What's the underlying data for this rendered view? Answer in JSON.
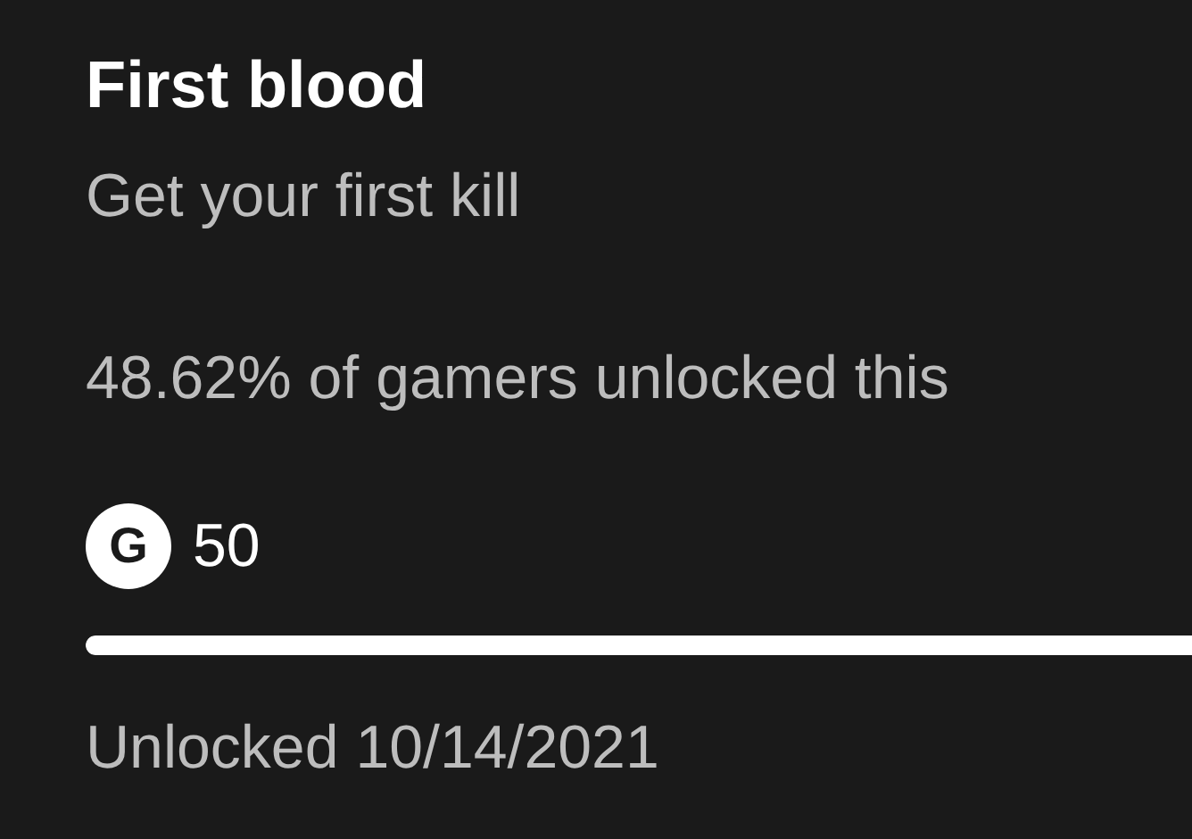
{
  "achievement": {
    "title": "First blood",
    "description": "Get your first kill",
    "rarity": "48.62% of gamers unlocked this",
    "gamerscore_badge": "G",
    "gamerscore": "50",
    "progress": {
      "level": 1
    },
    "unlocked_date": "Unlocked 10/14/2021"
  }
}
